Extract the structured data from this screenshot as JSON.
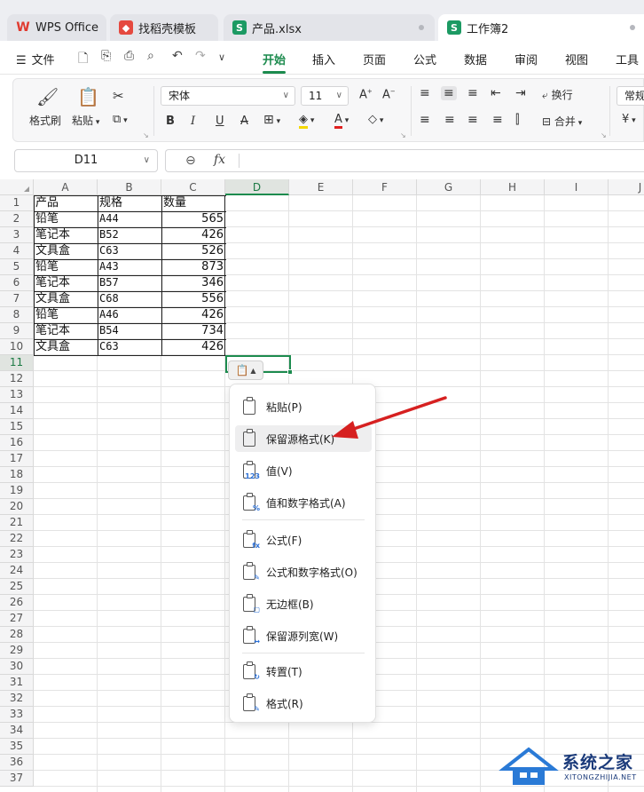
{
  "tabs": [
    {
      "label": "WPS Office",
      "icon": "wps-logo-icon"
    },
    {
      "label": "找稻壳模板",
      "icon": "daoke-icon"
    },
    {
      "label": "产品.xlsx",
      "icon": "spreadsheet-icon"
    },
    {
      "label": "工作簿2",
      "icon": "spreadsheet-icon"
    }
  ],
  "menubar": {
    "file": "文件",
    "items": [
      "开始",
      "插入",
      "页面",
      "公式",
      "数据",
      "审阅",
      "视图",
      "工具"
    ]
  },
  "ribbon": {
    "format_painter": "格式刷",
    "paste": "粘贴",
    "font_name": "宋体",
    "font_size": "11",
    "wrap": "换行",
    "merge": "合并",
    "normal": "常规",
    "currency": "¥",
    "bold": "B",
    "italic": "I",
    "underline": "U",
    "strike": "A"
  },
  "formula_bar": {
    "name_box": "D11",
    "fx": "fx"
  },
  "grid": {
    "columns": [
      "A",
      "B",
      "C",
      "D",
      "E",
      "F",
      "G",
      "H",
      "I",
      "J"
    ],
    "active_column": "D",
    "active_row": 11,
    "rows": [
      "1",
      "2",
      "3",
      "4",
      "5",
      "6",
      "7",
      "8",
      "9",
      "10",
      "11",
      "12",
      "13",
      "14",
      "15",
      "16",
      "17",
      "18",
      "19",
      "20",
      "21",
      "22",
      "23",
      "24",
      "25",
      "26",
      "27",
      "28",
      "29",
      "30",
      "31",
      "32",
      "33",
      "34",
      "35",
      "36",
      "37"
    ],
    "data": [
      [
        "产品",
        "规格",
        "数量"
      ],
      [
        "铅笔",
        "A44",
        "565"
      ],
      [
        "笔记本",
        "B52",
        "426"
      ],
      [
        "文具盒",
        "C63",
        "526"
      ],
      [
        "铅笔",
        "A43",
        "873"
      ],
      [
        "笔记本",
        "B57",
        "346"
      ],
      [
        "文具盒",
        "C68",
        "556"
      ],
      [
        "铅笔",
        "A46",
        "426"
      ],
      [
        "笔记本",
        "B54",
        "734"
      ],
      [
        "文具盒",
        "C63",
        "426"
      ]
    ]
  },
  "paste_menu": {
    "items": [
      {
        "label": "粘贴(P)",
        "icon": "paste-icon"
      },
      {
        "label": "保留源格式(K)",
        "icon": "keep-source-format-icon",
        "highlighted": true
      },
      {
        "label": "值(V)",
        "icon": "paste-values-icon"
      },
      {
        "label": "值和数字格式(A)",
        "icon": "values-number-format-icon"
      },
      {
        "label": "公式(F)",
        "icon": "paste-formula-icon"
      },
      {
        "label": "公式和数字格式(O)",
        "icon": "formula-number-format-icon"
      },
      {
        "label": "无边框(B)",
        "icon": "no-borders-icon"
      },
      {
        "label": "保留源列宽(W)",
        "icon": "keep-column-width-icon"
      },
      {
        "label": "转置(T)",
        "icon": "transpose-icon"
      },
      {
        "label": "格式(R)",
        "icon": "paste-format-icon"
      }
    ]
  },
  "colors": {
    "accent": "#1c8b4e",
    "arrow": "#e02020",
    "watermark": "#1a3a7a"
  },
  "watermark": {
    "title": "系统之家",
    "subtitle": "XITONGZHIJIA.NET"
  }
}
